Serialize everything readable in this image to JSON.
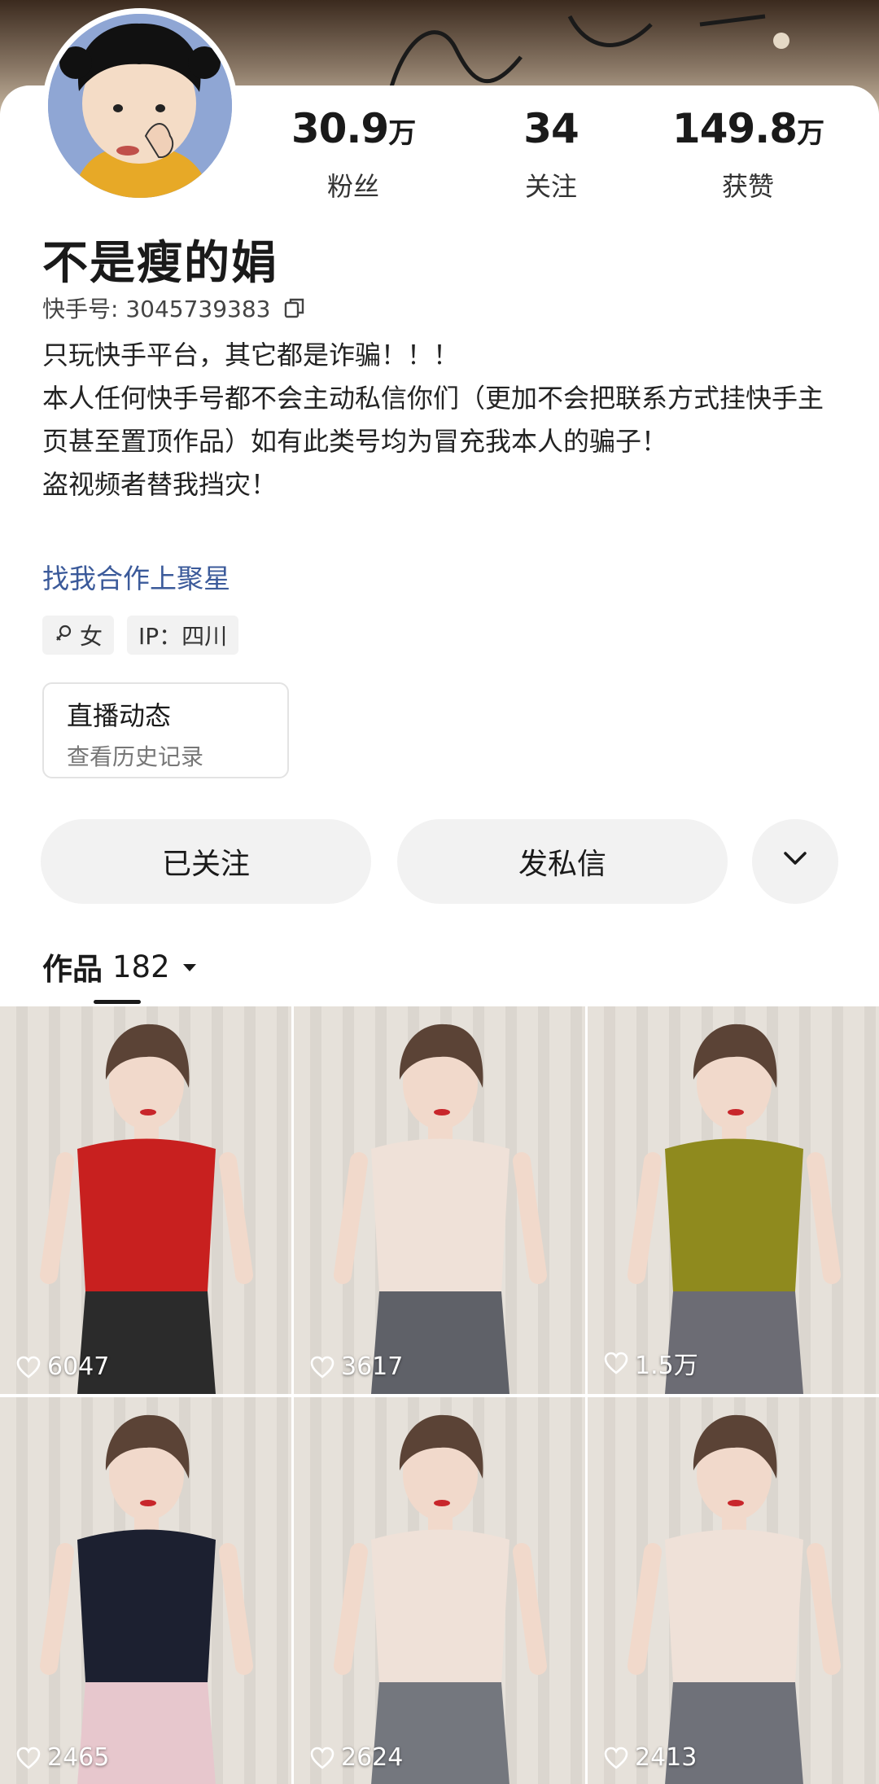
{
  "profile": {
    "name": "不是瘦的娟",
    "kuaishou_id_label": "快手号: 3045739383",
    "bio": [
      "只玩快手平台，其它都是诈骗！！！",
      "本人任何快手号都不会主动私信你们（更加不会把联系方式挂快手主页甚至置顶作品）如有此类号均为冒充我本人的骗子！",
      "盗视频者替我挡灾！"
    ],
    "cooperation_link": "找我合作上聚星",
    "tags": {
      "gender": "女",
      "ip": "IP：四川"
    }
  },
  "stats": {
    "fans": {
      "num": "30.9",
      "unit": "万",
      "label": "粉丝"
    },
    "following": {
      "num": "34",
      "unit": "",
      "label": "关注"
    },
    "likes": {
      "num": "149.8",
      "unit": "万",
      "label": "获赞"
    }
  },
  "live": {
    "title": "直播动态",
    "subtitle": "查看历史记录"
  },
  "actions": {
    "followed": "已关注",
    "message": "发私信",
    "more_icon": "chevron-down-icon"
  },
  "works": {
    "label": "作品",
    "count": "182"
  },
  "videos": [
    {
      "likes": "6047",
      "outfit": "#c8201f",
      "pants": "#2b2b2b"
    },
    {
      "likes": "3617",
      "outfit": "#efe1d8",
      "pants": "#5f6168"
    },
    {
      "likes": "1.5万",
      "outfit": "#8f8a1e",
      "pants": "#6c6c74"
    },
    {
      "likes": "2465",
      "outfit": "#1c2030",
      "pants": "#e7c7cd"
    },
    {
      "likes": "2624",
      "outfit": "#efe1d8",
      "pants": "#74777e"
    },
    {
      "likes": "2413",
      "outfit": "#efe1d8",
      "pants": "#6f7179"
    }
  ]
}
